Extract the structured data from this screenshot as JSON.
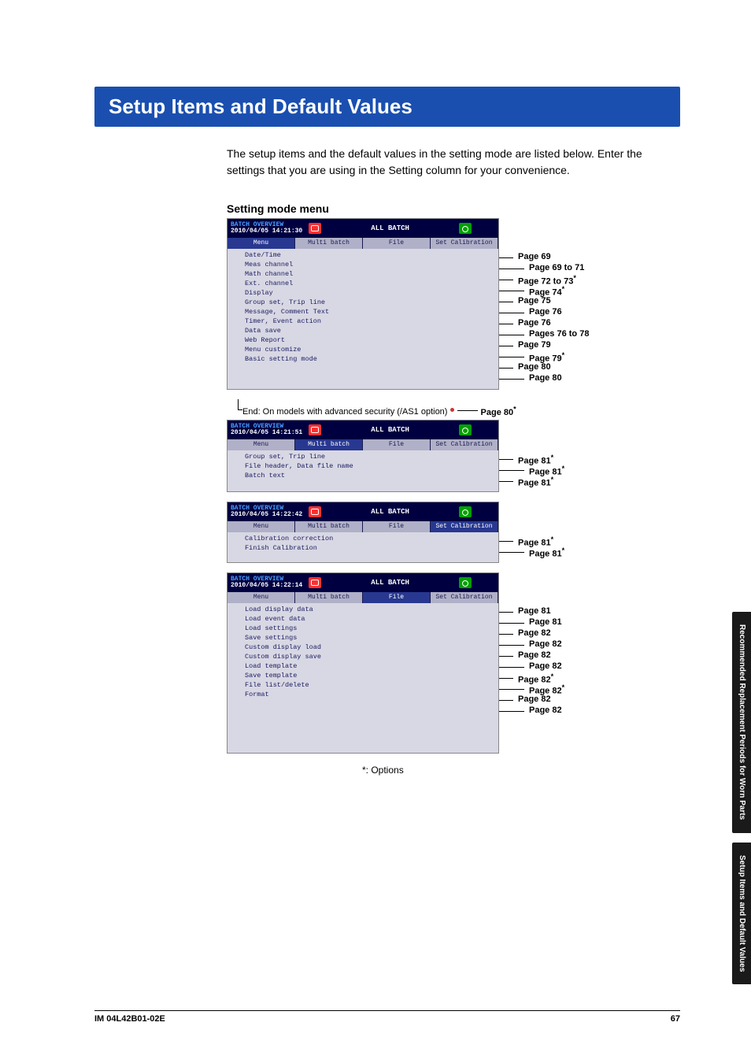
{
  "header": {
    "title": "Setup Items and Default Values"
  },
  "intro": "The setup items and the default values in the setting mode are listed below. Enter the settings that you are using in the Setting column for your convenience.",
  "subhead": "Setting mode menu",
  "footnote": "*: Options",
  "side_tabs": [
    "Recommended Replacement\nPeriods for Worn Parts",
    "Setup Items and\nDefault Values"
  ],
  "footer": {
    "left": "IM 04L42B01-02E",
    "right": "67"
  },
  "panels": [
    {
      "hdr_overview": "BATCH OVERVIEW",
      "hdr_time": "2010/04/05 14:21:30",
      "hdr_center": "ALL BATCH",
      "active_tab": 0,
      "tabs": [
        "Menu",
        "Multi batch",
        "File",
        "Set Calibration"
      ],
      "items": [
        {
          "label": "Date/Time",
          "page": "Page 69",
          "star": false,
          "arrow": true
        },
        {
          "label": "Meas channel",
          "page": "Page 69 to 71",
          "star": false,
          "arrow": true
        },
        {
          "label": "Math channel",
          "page": "Page 72 to 73",
          "star": true,
          "arrow": true
        },
        {
          "label": "Ext. channel",
          "page": "Page 74",
          "star": true,
          "arrow": true
        },
        {
          "label": "Display",
          "page": "Page 75",
          "star": false,
          "arrow": true
        },
        {
          "label": "Group set, Trip line",
          "page": "Page 76",
          "star": false,
          "arrow": false
        },
        {
          "label": "Message, Comment Text",
          "page": "Page 76",
          "star": false,
          "arrow": true
        },
        {
          "label": "Timer, Event action",
          "page": "Pages 76 to 78",
          "star": false,
          "arrow": true
        },
        {
          "label": "Data save",
          "page": "Page 79",
          "star": false,
          "arrow": true
        },
        {
          "label": "Web Report",
          "page": "Page 79",
          "star": true,
          "arrow": false
        },
        {
          "label": "Menu customize",
          "page": "Page 80",
          "star": false,
          "arrow": true
        },
        {
          "label": "Basic setting mode",
          "page": "Page 80",
          "star": false,
          "arrow": false
        }
      ],
      "body_height": 178
    },
    {
      "hdr_overview": "BATCH OVERVIEW",
      "hdr_time": "2010/04/05 14:21:51",
      "hdr_center": "ALL BATCH",
      "active_tab": 1,
      "tabs": [
        "Menu",
        "Multi batch",
        "File",
        "Set Calibration"
      ],
      "items": [
        {
          "label": "Group set, Trip line",
          "page": "Page 81",
          "star": true,
          "arrow": false
        },
        {
          "label": "File header, Data file name",
          "page": "Page 81",
          "star": true,
          "arrow": false
        },
        {
          "label": "Batch text",
          "page": "Page 81",
          "star": true,
          "arrow": false
        }
      ],
      "body_height": 52
    },
    {
      "hdr_overview": "BATCH OVERVIEW",
      "hdr_time": "2010/04/05 14:22:42",
      "hdr_center": "ALL BATCH",
      "active_tab": 3,
      "tabs": [
        "Menu",
        "Multi batch",
        "File",
        "Set Calibration"
      ],
      "items": [
        {
          "label": "Calibration correction",
          "page": "Page 81",
          "star": true,
          "arrow": false
        },
        {
          "label": "Finish Calibration",
          "page": "Page 81",
          "star": true,
          "arrow": false
        }
      ],
      "body_height": 38
    },
    {
      "hdr_overview": "BATCH OVERVIEW",
      "hdr_time": "2010/04/05 14:22:14",
      "hdr_center": "ALL BATCH",
      "active_tab": 2,
      "tabs": [
        "Menu",
        "Multi batch",
        "File",
        "Set Calibration"
      ],
      "items": [
        {
          "label": "Load display data",
          "page": "Page 81",
          "star": false,
          "arrow": false
        },
        {
          "label": "Load event data",
          "page": "Page 81",
          "star": false,
          "arrow": false
        },
        {
          "label": "Load settings",
          "page": "Page 82",
          "star": false,
          "arrow": false
        },
        {
          "label": "Save settings",
          "page": "Page 82",
          "star": false,
          "arrow": false
        },
        {
          "label": "Custom display load",
          "page": "Page 82",
          "star": false,
          "arrow": true
        },
        {
          "label": "Custom display save",
          "page": "Page 82",
          "star": false,
          "arrow": true
        },
        {
          "label": "Load template",
          "page": "Page 82",
          "star": true,
          "arrow": false
        },
        {
          "label": "Save template",
          "page": "Page 82",
          "star": true,
          "arrow": false
        },
        {
          "label": "File list/delete",
          "page": "Page 82",
          "star": false,
          "arrow": false
        },
        {
          "label": "Format",
          "page": "Page 82",
          "star": false,
          "arrow": false
        }
      ],
      "body_height": 190
    }
  ],
  "as1_note": {
    "text": "End: On models with advanced security (/AS1 option)",
    "page": "Page 80",
    "star": true
  }
}
